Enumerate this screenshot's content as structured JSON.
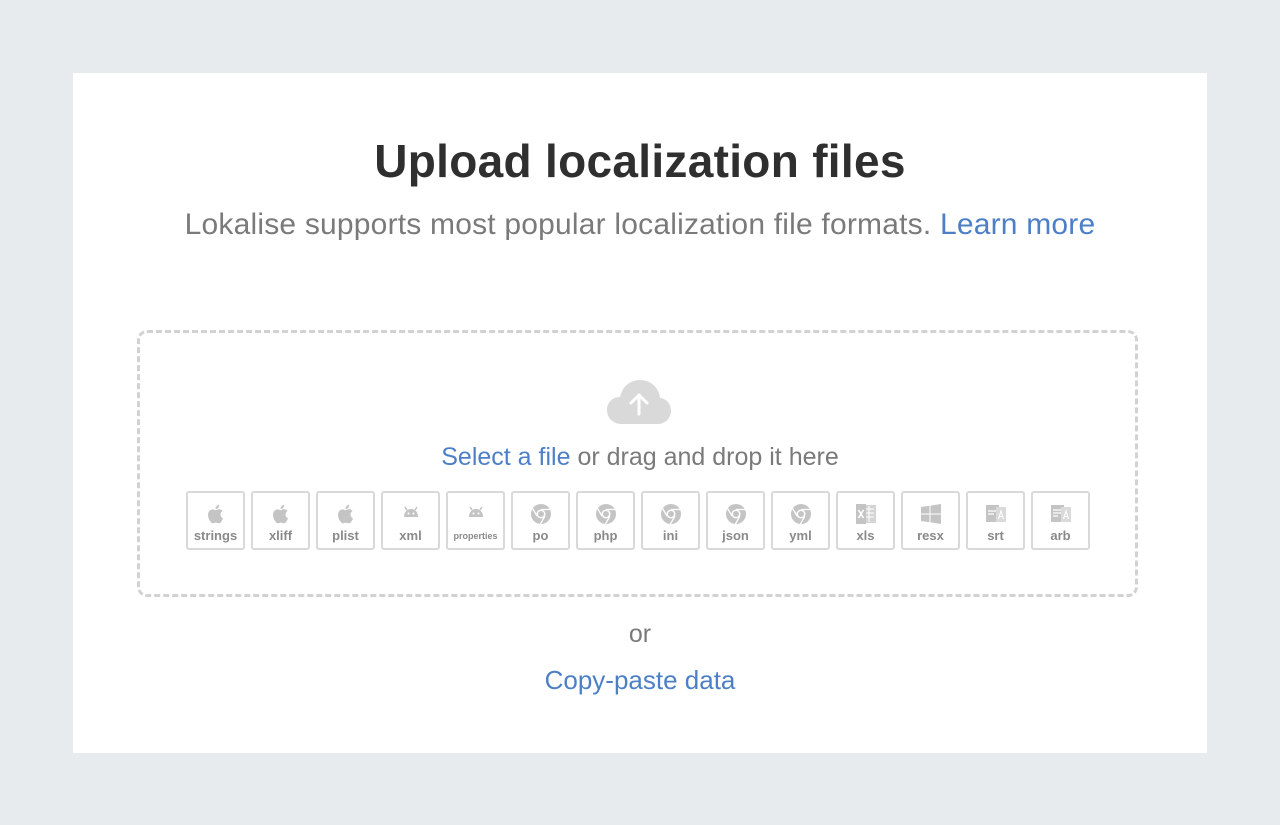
{
  "header": {
    "title": "Upload localization files",
    "subtitle": "Lokalise supports most popular localization file formats.",
    "learn_more": "Learn more"
  },
  "dropzone": {
    "select_file": "Select a file",
    "drag_text": " or drag and drop it here",
    "icon": "cloud-upload-icon",
    "formats": [
      {
        "label": "strings",
        "icon": "apple-icon"
      },
      {
        "label": "xliff",
        "icon": "apple-icon"
      },
      {
        "label": "plist",
        "icon": "apple-icon"
      },
      {
        "label": "xml",
        "icon": "android-icon"
      },
      {
        "label": "properties",
        "icon": "android-icon"
      },
      {
        "label": "po",
        "icon": "chrome-icon"
      },
      {
        "label": "php",
        "icon": "chrome-icon"
      },
      {
        "label": "ini",
        "icon": "chrome-icon"
      },
      {
        "label": "json",
        "icon": "chrome-icon"
      },
      {
        "label": "yml",
        "icon": "chrome-icon"
      },
      {
        "label": "xls",
        "icon": "excel-icon"
      },
      {
        "label": "resx",
        "icon": "windows-icon"
      },
      {
        "label": "srt",
        "icon": "subtitle-icon"
      },
      {
        "label": "arb",
        "icon": "arb-icon"
      }
    ]
  },
  "footer": {
    "or": "or",
    "copy_paste": "Copy-paste data"
  },
  "colors": {
    "background": "#e8ebed",
    "link": "#4d7fc7",
    "text_muted": "#7a7a7a",
    "title": "#2f2f2f"
  }
}
